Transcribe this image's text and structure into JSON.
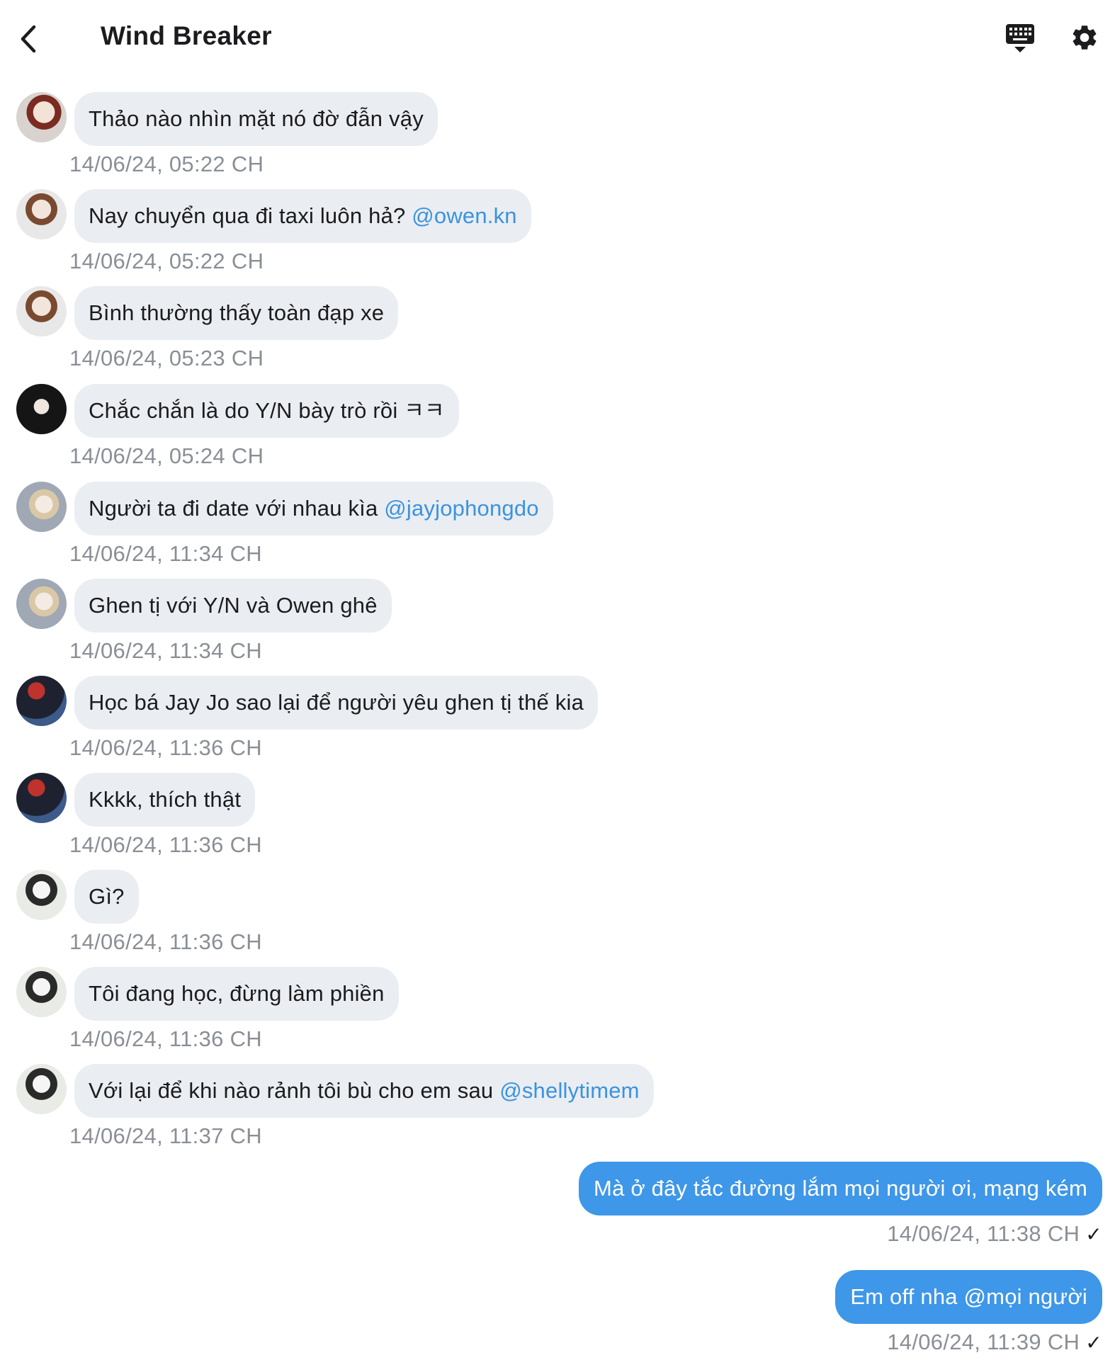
{
  "header": {
    "title": "Wind Breaker",
    "back_icon": "chevron-left-icon",
    "keyboard_icon": "keyboard-icon",
    "settings_icon": "gear-icon"
  },
  "messages": [
    {
      "text": "Thảo nào nhìn mặt nó đờ đẫn vậy",
      "mention": "",
      "time": "14/06/24, 05:22 CH"
    },
    {
      "text": "Nay chuyển qua đi taxi luôn hả? ",
      "mention": "@owen.kn",
      "time": "14/06/24, 05:22 CH"
    },
    {
      "text": "Bình thường thấy toàn đạp xe",
      "mention": "",
      "time": "14/06/24, 05:23 CH"
    },
    {
      "text": "Chắc chắn là do Y/N bày trò rồi ㅋㅋ",
      "mention": "",
      "time": "14/06/24, 05:24 CH"
    },
    {
      "text": "Người ta đi date với nhau kìa ",
      "mention": "@jayjophongdo",
      "time": "14/06/24, 11:34 CH"
    },
    {
      "text": "Ghen tị với Y/N và Owen ghê",
      "mention": "",
      "time": "14/06/24, 11:34 CH"
    },
    {
      "text": "Học bá Jay Jo sao lại để người yêu ghen tị thế kia",
      "mention": "",
      "time": "14/06/24, 11:36 CH"
    },
    {
      "text": "Kkkk, thích thật",
      "mention": "",
      "time": "14/06/24, 11:36 CH"
    },
    {
      "text": "Gì?",
      "mention": "",
      "time": "14/06/24, 11:36 CH"
    },
    {
      "text": "Tôi đang học, đừng làm phiền",
      "mention": "",
      "time": "14/06/24, 11:36 CH"
    },
    {
      "text": "Với lại để khi nào rảnh tôi bù cho em sau ",
      "mention": "@shellytimem",
      "time": "14/06/24, 11:37 CH"
    }
  ],
  "outgoing": [
    {
      "text": "Mà ở đây tắc đường lắm mọi người ơi, mạng kém",
      "time": "14/06/24, 11:38 CH",
      "check": "✓"
    },
    {
      "text": "Em off nha @mọi người",
      "time": "14/06/24, 11:39 CH",
      "check": "✓"
    }
  ],
  "colors": {
    "incoming_bubble": "#eaedf1",
    "outgoing_bubble": "#3e97e8",
    "mention": "#3a93e0",
    "timestamp": "#8a8f96"
  }
}
